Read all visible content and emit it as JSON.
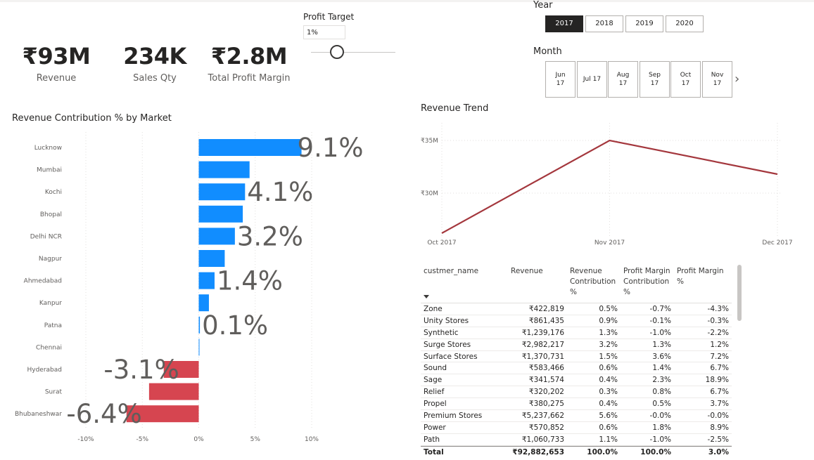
{
  "kpis": [
    {
      "value": "₹93M",
      "label": "Revenue"
    },
    {
      "value": "234K",
      "label": "Sales Qty"
    },
    {
      "value": "₹2.8M",
      "label": "Total Profit Margin"
    }
  ],
  "profit_target": {
    "title": "Profit Target",
    "value": "1%",
    "slider_position": 0.33
  },
  "year_slicer": {
    "title": "Year",
    "options": [
      "2017",
      "2018",
      "2019",
      "2020"
    ],
    "selected": "2017"
  },
  "month_slicer": {
    "title": "Month",
    "options": [
      [
        "Jun",
        "17"
      ],
      [
        "Jul 17",
        ""
      ],
      [
        "Aug",
        "17"
      ],
      [
        "Sep",
        "17"
      ],
      [
        "Oct",
        "17"
      ],
      [
        "Nov",
        "17"
      ]
    ],
    "more_icon": "chevron-right-icon"
  },
  "colors": {
    "positive": "#118dff",
    "negative": "#d64550",
    "trend_line": "#a4373d"
  },
  "bar_chart": {
    "title": "Revenue Contribution % by Market",
    "chart_data": {
      "type": "bar",
      "orientation": "horizontal",
      "categories": [
        "Lucknow",
        "Mumbai",
        "Kochi",
        "Bhopal",
        "Delhi NCR",
        "Nagpur",
        "Ahmedabad",
        "Kanpur",
        "Patna",
        "Chennai",
        "Hyderabad",
        "Surat",
        "Bhubaneshwar"
      ],
      "values": [
        9.1,
        4.5,
        4.1,
        3.9,
        3.2,
        2.3,
        1.4,
        0.9,
        0.1,
        0.05,
        -3.1,
        -4.4,
        -6.4
      ],
      "data_labels": [
        "9.1%",
        "",
        "4.1%",
        "",
        "3.2%",
        "",
        "1.4%",
        "",
        "0.1%",
        "",
        "-3.1%",
        "",
        "-6.4%"
      ],
      "xlim": [
        -10,
        10
      ],
      "xticks": [
        "-10%",
        "-5%",
        "0%",
        "5%",
        "10%"
      ],
      "xtick_values": [
        -10,
        -5,
        0,
        5,
        10
      ],
      "grid": true
    }
  },
  "trend_chart": {
    "title": "Revenue Trend",
    "chart_data": {
      "type": "line",
      "x": [
        "Oct 2017",
        "Nov 2017",
        "Dec 2017"
      ],
      "values": [
        26.2,
        35.0,
        31.8
      ],
      "ylim": [
        25,
        37
      ],
      "yticks": [
        "₹30M",
        "₹35M"
      ],
      "ytick_values": [
        30,
        35
      ],
      "grid": true
    }
  },
  "table": {
    "columns": [
      "custmer_name",
      "Revenue",
      "Revenue Contribution %",
      "Profit Margin Contribution %",
      "Profit Margin %"
    ],
    "rows": [
      [
        "Zone",
        "₹422,819",
        "0.5%",
        "-0.7%",
        "-4.3%"
      ],
      [
        "Unity Stores",
        "₹861,435",
        "0.9%",
        "-0.1%",
        "-0.3%"
      ],
      [
        "Synthetic",
        "₹1,239,176",
        "1.3%",
        "-1.0%",
        "-2.2%"
      ],
      [
        "Surge Stores",
        "₹2,982,217",
        "3.2%",
        "1.3%",
        "1.2%"
      ],
      [
        "Surface Stores",
        "₹1,370,731",
        "1.5%",
        "3.6%",
        "7.2%"
      ],
      [
        "Sound",
        "₹583,466",
        "0.6%",
        "1.4%",
        "6.7%"
      ],
      [
        "Sage",
        "₹341,574",
        "0.4%",
        "2.3%",
        "18.9%"
      ],
      [
        "Relief",
        "₹320,202",
        "0.3%",
        "0.8%",
        "6.7%"
      ],
      [
        "Propel",
        "₹380,275",
        "0.4%",
        "0.5%",
        "3.7%"
      ],
      [
        "Premium Stores",
        "₹5,237,662",
        "5.6%",
        "-0.0%",
        "-0.0%"
      ],
      [
        "Power",
        "₹570,852",
        "0.6%",
        "1.8%",
        "8.9%"
      ],
      [
        "Path",
        "₹1,060,733",
        "1.1%",
        "-1.0%",
        "-2.5%"
      ]
    ],
    "total": [
      "Total",
      "₹92,882,653",
      "100.0%",
      "100.0%",
      "3.0%"
    ]
  }
}
